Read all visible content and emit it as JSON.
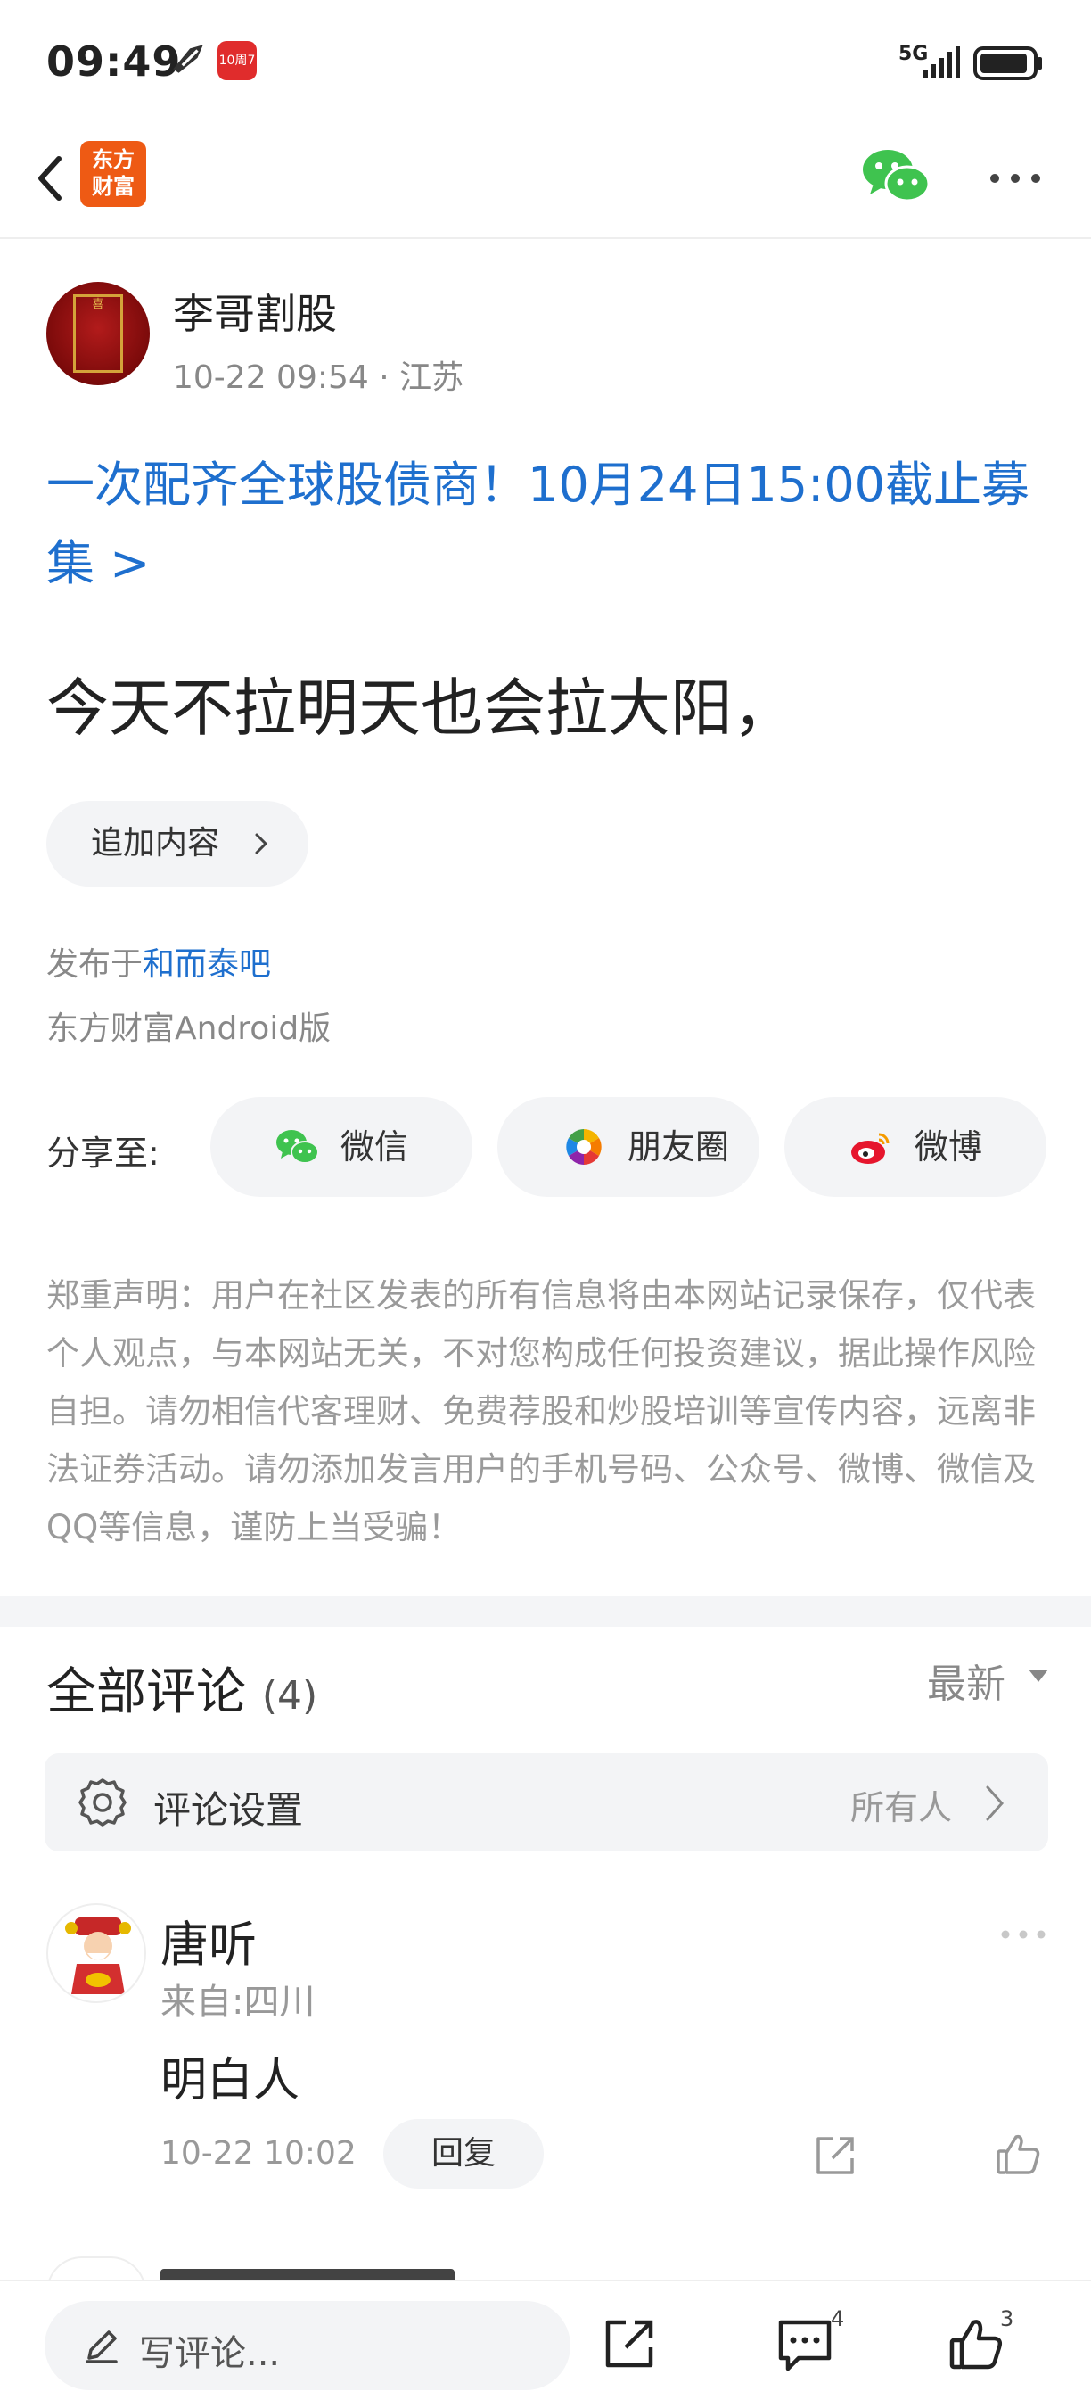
{
  "status_bar": {
    "time": "09:49",
    "network": "5G",
    "app_badge": "10周7"
  },
  "nav": {
    "logo_text": "东方\n财富",
    "colors": {
      "logo_bg": "#ee5a14",
      "wechat_green": "#3fc34f"
    }
  },
  "author": {
    "name": "李哥割股",
    "meta": "10-22 09:54 · 江苏",
    "avatar_text": "喜"
  },
  "promo": {
    "text": "一次配齐全球股债商！10月24日15:00截止募集 >",
    "color": "#1e6fce"
  },
  "post": {
    "body": "今天不拉明天也会拉大阳，"
  },
  "append_button": {
    "label": "追加内容"
  },
  "published": {
    "prefix": "发布于",
    "bar": "和而泰吧",
    "client": "东方财富Android版"
  },
  "share": {
    "label": "分享至:",
    "targets": [
      {
        "label": "微信",
        "icon": "wechat-icon"
      },
      {
        "label": "朋友圈",
        "icon": "moments-icon"
      },
      {
        "label": "微博",
        "icon": "weibo-icon"
      }
    ]
  },
  "disclaimer": "郑重声明：用户在社区发表的所有信息将由本网站记录保存，仅代表个人观点，与本网站无关，不对您构成任何投资建议，据此操作风险自担。请勿相信代客理财、免费荐股和炒股培训等宣传内容，远离非法证券活动。请勿添加发言用户的手机号码、公众号、微博、微信及QQ等信息，谨防上当受骗！",
  "comments": {
    "title": "全部评论",
    "count": "(4)",
    "sort": "最新",
    "settings": {
      "label": "评论设置",
      "value": "所有人"
    },
    "items": [
      {
        "name": "唐听",
        "from": "来自:四川",
        "text": "明白人",
        "time": "10-22 10:02",
        "reply_label": "回复"
      }
    ]
  },
  "bottom_bar": {
    "write_placeholder": "写评论...",
    "comment_count": "4",
    "like_count": "3"
  }
}
